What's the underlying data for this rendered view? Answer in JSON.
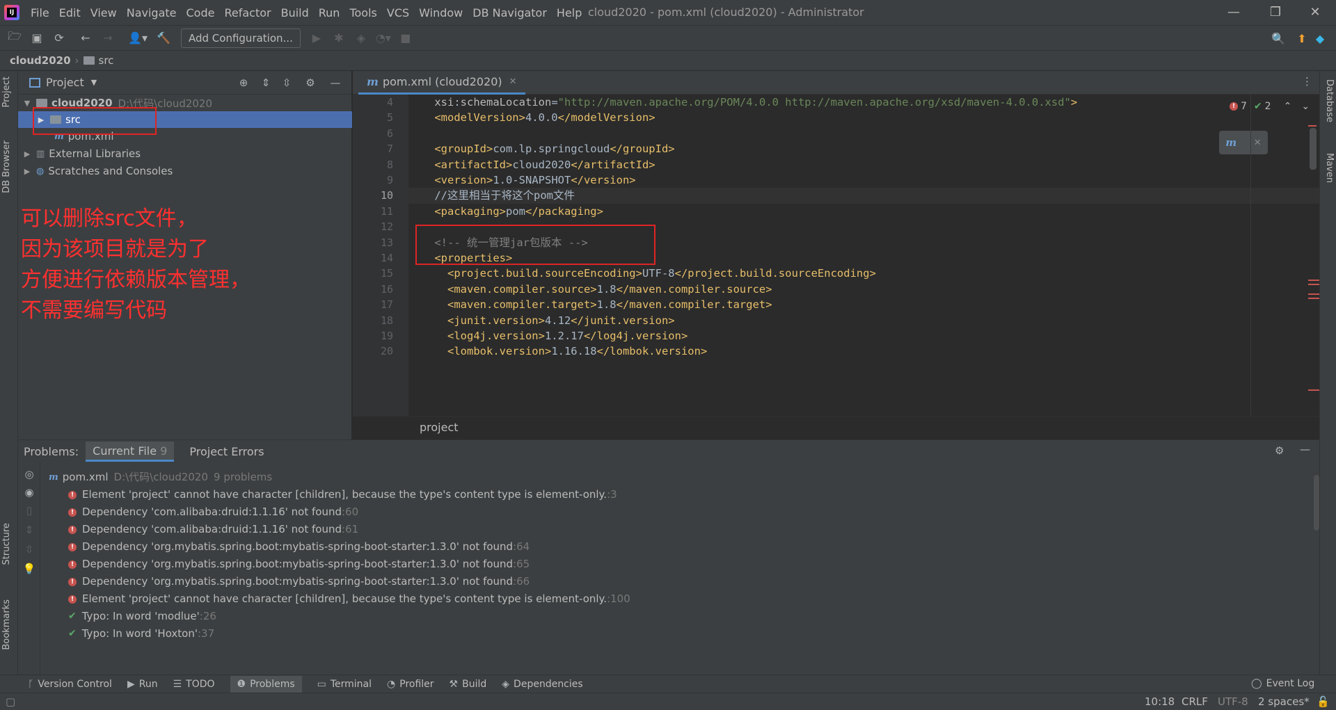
{
  "menu": [
    "File",
    "Edit",
    "View",
    "Navigate",
    "Code",
    "Refactor",
    "Build",
    "Run",
    "Tools",
    "VCS",
    "Window",
    "DB Navigator",
    "Help"
  ],
  "window_title": "cloud2020 - pom.xml (cloud2020) - Administrator",
  "toolbar": {
    "add_config": "Add Configuration..."
  },
  "breadcrumb": {
    "project": "cloud2020",
    "folder": "src"
  },
  "left_tabs": {
    "project": "Project",
    "db_browser": "DB Browser",
    "structure": "Structure",
    "bookmarks": "Bookmarks"
  },
  "right_tabs": {
    "database": "Database",
    "maven": "Maven"
  },
  "project_panel": {
    "title": "Project",
    "tree": [
      {
        "label": "cloud2020",
        "path": "D:\\代码\\cloud2020"
      },
      {
        "label": "src"
      },
      {
        "label": "pom.xml"
      },
      {
        "label": "External Libraries"
      },
      {
        "label": "Scratches and Consoles"
      }
    ]
  },
  "annotation": [
    "可以删除src文件，",
    "因为该项目就是为了",
    "方便进行依赖版本管理，",
    "不需要编写代码"
  ],
  "editor": {
    "tab": "pom.xml (cloud2020)",
    "inspection": {
      "errors": "7",
      "warnings": "2"
    },
    "line_numbers": [
      "4",
      "5",
      "6",
      "7",
      "8",
      "9",
      "10",
      "11",
      "12",
      "13",
      "14",
      "15",
      "16",
      "17",
      "18",
      "19",
      "20"
    ],
    "current_line": "10",
    "code": [
      {
        "parts": [
          [
            "attr",
            "    xsi"
          ],
          [
            "txt",
            ":"
          ],
          [
            "attr",
            "schemaLocation"
          ],
          [
            "txt",
            "="
          ],
          [
            "val",
            "\"http://maven.apache.org/POM/4.0.0 http://maven.apache.org/xsd/maven-4.0.0.xsd\""
          ],
          [
            "tag",
            ">"
          ]
        ]
      },
      {
        "parts": [
          [
            "tag",
            "    <modelVersion>"
          ],
          [
            "txt",
            "4.0.0"
          ],
          [
            "tag",
            "</modelVersion>"
          ]
        ]
      },
      {
        "parts": [
          [
            "txt",
            ""
          ]
        ]
      },
      {
        "parts": [
          [
            "tag",
            "    <groupId>"
          ],
          [
            "txt",
            "com.lp.springcloud"
          ],
          [
            "tag",
            "</groupId>"
          ]
        ]
      },
      {
        "parts": [
          [
            "tag",
            "    <artifactId>"
          ],
          [
            "txt",
            "cloud2020"
          ],
          [
            "tag",
            "</artifactId>"
          ]
        ]
      },
      {
        "parts": [
          [
            "tag",
            "    <version>"
          ],
          [
            "txt",
            "1.0-SNAPSHOT"
          ],
          [
            "tag",
            "</version>"
          ]
        ]
      },
      {
        "parts": [
          [
            "txt",
            "    //这里相当于将这个pom文件"
          ]
        ]
      },
      {
        "parts": [
          [
            "tag",
            "    <packaging>"
          ],
          [
            "txt",
            "pom"
          ],
          [
            "tag",
            "</packaging>"
          ]
        ]
      },
      {
        "parts": [
          [
            "txt",
            ""
          ]
        ]
      },
      {
        "parts": [
          [
            "cmt",
            "    <!-- 统一管理jar包版本 -->"
          ]
        ]
      },
      {
        "parts": [
          [
            "tag",
            "    <properties>"
          ]
        ]
      },
      {
        "parts": [
          [
            "tag",
            "      <project.build.sourceEncoding>"
          ],
          [
            "txt",
            "UTF-8"
          ],
          [
            "tag",
            "</project.build.sourceEncoding>"
          ]
        ]
      },
      {
        "parts": [
          [
            "tag",
            "      <maven.compiler.source>"
          ],
          [
            "txt",
            "1.8"
          ],
          [
            "tag",
            "</maven.compiler.source>"
          ]
        ]
      },
      {
        "parts": [
          [
            "tag",
            "      <maven.compiler.target>"
          ],
          [
            "txt",
            "1.8"
          ],
          [
            "tag",
            "</maven.compiler.target>"
          ]
        ]
      },
      {
        "parts": [
          [
            "tag",
            "      <junit.version>"
          ],
          [
            "txt",
            "4.12"
          ],
          [
            "tag",
            "</junit.version>"
          ]
        ]
      },
      {
        "parts": [
          [
            "tag",
            "      <log4j.version>"
          ],
          [
            "txt",
            "1.2.17"
          ],
          [
            "tag",
            "</log4j.version>"
          ]
        ]
      },
      {
        "parts": [
          [
            "tag",
            "      <lombok.version>"
          ],
          [
            "txt",
            "1.16.18"
          ],
          [
            "tag",
            "</lombok.version>"
          ]
        ]
      }
    ],
    "footer_breadcrumb": "project"
  },
  "problems": {
    "label": "Problems:",
    "tabs": [
      {
        "label": "Current File",
        "count": "9"
      },
      {
        "label": "Project Errors"
      }
    ],
    "file": {
      "name": "pom.xml",
      "path": "D:\\代码\\cloud2020",
      "count": "9 problems"
    },
    "items": [
      {
        "type": "error",
        "text": "Element 'project' cannot have character [children], because the type's content type is element-only.",
        "line": ":3"
      },
      {
        "type": "error",
        "text": "Dependency 'com.alibaba:druid:1.1.16' not found",
        "line": ":60"
      },
      {
        "type": "error",
        "text": "Dependency 'com.alibaba:druid:1.1.16' not found",
        "line": ":61"
      },
      {
        "type": "error",
        "text": "Dependency 'org.mybatis.spring.boot:mybatis-spring-boot-starter:1.3.0' not found",
        "line": ":64"
      },
      {
        "type": "error",
        "text": "Dependency 'org.mybatis.spring.boot:mybatis-spring-boot-starter:1.3.0' not found",
        "line": ":65"
      },
      {
        "type": "error",
        "text": "Dependency 'org.mybatis.spring.boot:mybatis-spring-boot-starter:1.3.0' not found",
        "line": ":66"
      },
      {
        "type": "error",
        "text": "Element 'project' cannot have character [children], because the type's content type is element-only.",
        "line": ":100"
      },
      {
        "type": "typo",
        "text": "Typo: In word 'modlue'",
        "line": ":26"
      },
      {
        "type": "typo",
        "text": "Typo: In word 'Hoxton'",
        "line": ":37"
      }
    ]
  },
  "bottom_tabs": [
    "Version Control",
    "Run",
    "TODO",
    "Problems",
    "Terminal",
    "Profiler",
    "Build",
    "Dependencies"
  ],
  "event_log": "Event Log",
  "status": {
    "position": "10:18",
    "line_sep": "CRLF",
    "encoding": "UTF-8",
    "indent": "2 spaces*"
  }
}
